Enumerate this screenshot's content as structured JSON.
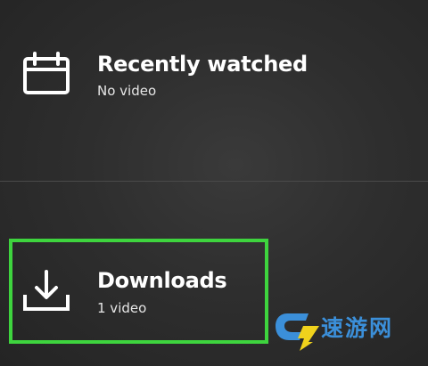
{
  "recently_watched": {
    "title": "Recently watched",
    "subtitle": "No video",
    "icon": "calendar-icon"
  },
  "downloads": {
    "title": "Downloads",
    "subtitle": "1 video",
    "icon": "download-icon"
  },
  "highlight": {
    "color": "#3ed43e"
  },
  "watermark": {
    "text": "速游网",
    "color": "#3b8fd9"
  }
}
